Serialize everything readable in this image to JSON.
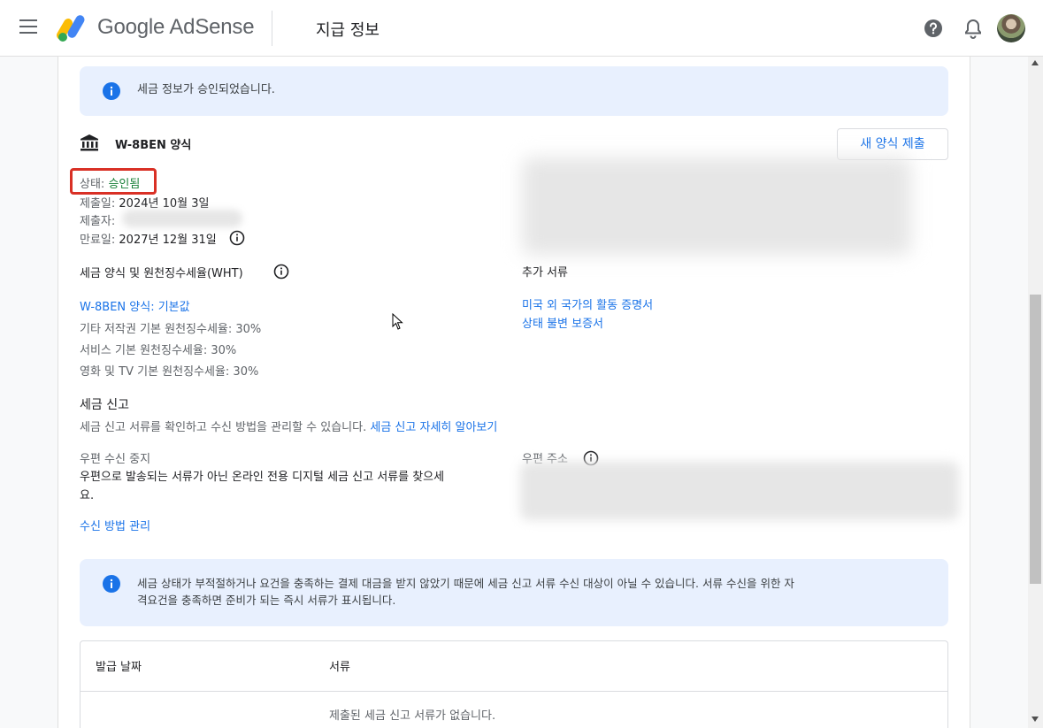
{
  "header": {
    "brand_google": "Google",
    "brand_product": "AdSense",
    "page_title": "지급 정보"
  },
  "notice_top": {
    "text": "세금 정보가 승인되었습니다."
  },
  "form": {
    "name": "W-8BEN 양식",
    "new_form_button": "새 양식 제출",
    "status_label": "상태:",
    "status_value": "승인됨",
    "submitted_label": "제출일:",
    "submitted_value": "2024년 10월 3일",
    "submitter_label": "제출자:",
    "expiry_label": "만료일:",
    "expiry_value": "2027년 12월 31일"
  },
  "wht": {
    "heading": "세금 양식 및 원천징수세율(WHT)",
    "form_link": "W-8BEN 양식: 기본값",
    "rates": [
      "기타 저작권 기본 원천징수세율: 30%",
      "서비스 기본 원천징수세율: 30%",
      "영화 및 TV 기본 원천징수세율: 30%"
    ]
  },
  "extra_docs": {
    "heading": "추가 서류",
    "links": [
      "미국 외 국가의 활동 증명서",
      "상태 불변 보증서"
    ]
  },
  "tax_filing": {
    "heading": "세금 신고",
    "description": "세금 신고 서류를 확인하고 수신 방법을 관리할 수 있습니다.",
    "learn_more": "세금 신고 자세히 알아보기"
  },
  "mail_stop": {
    "heading": "우편 수신 중지",
    "line1": "우편으로 발송되는 서류가 아닌 온라인 전용 디지털 세금 신고 서류를 찾으세",
    "line2": "요.",
    "manage_link": "수신 방법 관리"
  },
  "mail_address": {
    "heading": "우편 주소"
  },
  "notice_bottom": {
    "line1": "세금 상태가 부적절하거나 요건을 충족하는 결제 대금을 받지 않았기 때문에 세금 신고 서류 수신 대상이 아닐 수 있습니다. 서류 수신을 위한 자",
    "line2": "격요건을 충족하면 준비가 되는 즉시 서류가 표시됩니다."
  },
  "table": {
    "col_date": "발급 날짜",
    "col_docs": "서류",
    "empty": "제출된 세금 신고 서류가 없습니다."
  },
  "colors": {
    "link": "#1a73e8",
    "status_approved": "#188038",
    "highlight_box": "#d93025",
    "banner_bg": "#e8f0fe"
  }
}
